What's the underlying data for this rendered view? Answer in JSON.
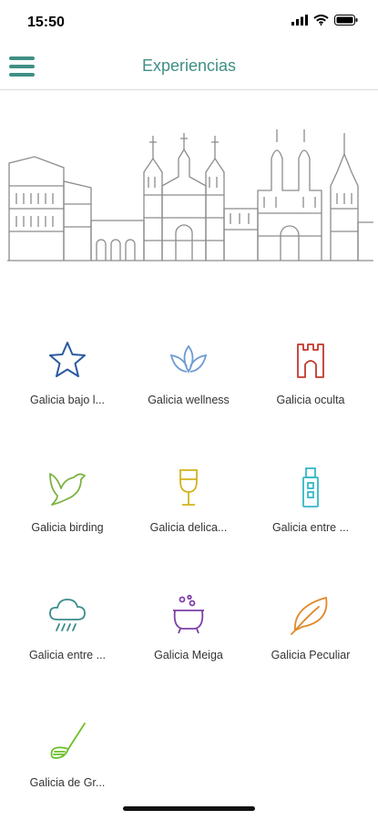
{
  "status_bar": {
    "time": "15:50"
  },
  "header": {
    "title": "Experiencias"
  },
  "experiences": [
    {
      "label": "Galicia bajo l...",
      "icon": "star-icon",
      "color": "#2c5aa0"
    },
    {
      "label": "Galicia wellness",
      "icon": "lotus-icon",
      "color": "#6e9bd3"
    },
    {
      "label": "Galicia oculta",
      "icon": "tower-icon",
      "color": "#c0392b"
    },
    {
      "label": "Galicia birding",
      "icon": "bird-icon",
      "color": "#7cb342"
    },
    {
      "label": "Galicia delica...",
      "icon": "wine-glass-icon",
      "color": "#d4b21a"
    },
    {
      "label": "Galicia entre ...",
      "icon": "usb-icon",
      "color": "#35b8c7"
    },
    {
      "label": "Galicia entre ...",
      "icon": "rain-cloud-icon",
      "color": "#3c8c8c"
    },
    {
      "label": "Galicia Meiga",
      "icon": "cauldron-icon",
      "color": "#7e3fa8"
    },
    {
      "label": "Galicia Peculiar",
      "icon": "leaf-icon",
      "color": "#e08a2c"
    },
    {
      "label": "Galicia de Gr...",
      "icon": "golf-club-icon",
      "color": "#6cbf2a"
    }
  ]
}
